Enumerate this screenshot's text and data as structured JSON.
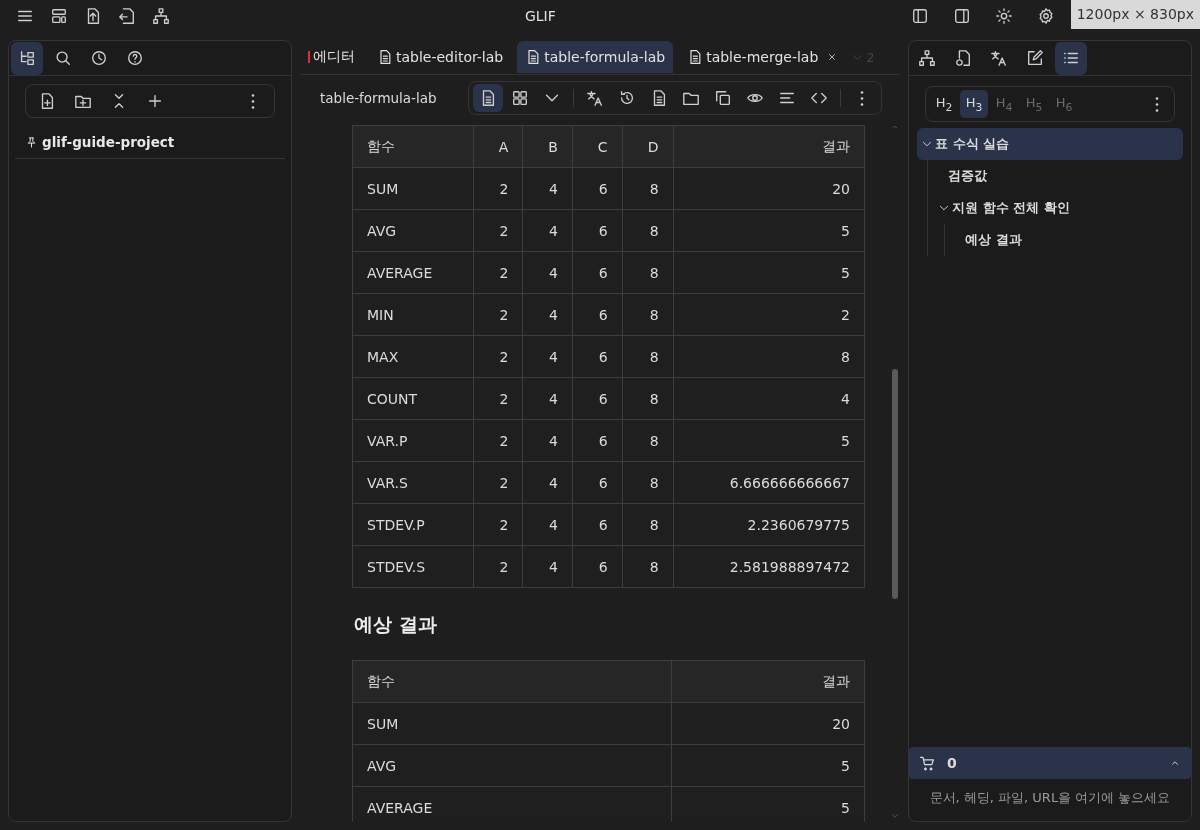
{
  "window": {
    "title": "GLIF",
    "left_icons": [
      {
        "kind": "menu"
      },
      {
        "kind": "layout"
      },
      {
        "kind": "export"
      },
      {
        "kind": "import"
      },
      {
        "kind": "tree"
      }
    ],
    "right_icons": [
      {
        "kind": "sidebar-left"
      },
      {
        "kind": "sidebar-right"
      },
      {
        "kind": "sun"
      },
      {
        "kind": "gear"
      }
    ]
  },
  "size_badge": "1200px × 830px",
  "left_panel": {
    "tabs": [
      {
        "kind": "files",
        "selected": true
      },
      {
        "kind": "search",
        "selected": false
      },
      {
        "kind": "clock",
        "selected": false
      },
      {
        "kind": "help",
        "selected": false
      }
    ],
    "tools": [
      {
        "kind": "new-file"
      },
      {
        "kind": "new-folder"
      },
      {
        "kind": "collapse"
      },
      {
        "kind": "plus"
      }
    ],
    "items": [
      {
        "label": "glif-guide-project",
        "pinned": true
      }
    ]
  },
  "editor": {
    "tabs": [
      {
        "label": "에디터",
        "selected": false,
        "warning": true,
        "closable": false
      },
      {
        "label": "table-editor-lab",
        "selected": false,
        "warning": false,
        "closable": false
      },
      {
        "label": "table-formula-lab",
        "selected": true,
        "warning": false,
        "closable": false
      },
      {
        "label": "table-merge-lab",
        "selected": false,
        "warning": false,
        "closable": true
      }
    ],
    "overflow_count": "2",
    "breadcrumb": "table-formula-lab",
    "toolbar": [
      {
        "kind": "doc",
        "selected": true
      },
      {
        "kind": "grid",
        "selected": false
      },
      {
        "kind": "chevron",
        "selected": false
      },
      {
        "kind": "translate",
        "selected": false
      },
      {
        "kind": "history",
        "selected": false
      },
      {
        "kind": "doc",
        "selected": false
      },
      {
        "kind": "folder",
        "selected": false
      },
      {
        "kind": "copy",
        "selected": false
      },
      {
        "kind": "eye",
        "selected": false
      },
      {
        "kind": "align",
        "selected": false
      },
      {
        "kind": "code",
        "selected": false
      }
    ],
    "blocks": [
      {
        "kind": "table",
        "columns": [
          "함수",
          "A",
          "B",
          "C",
          "D",
          "결과"
        ],
        "rows": [
          [
            "SUM",
            "2",
            "4",
            "6",
            "8",
            "20"
          ],
          [
            "AVG",
            "2",
            "4",
            "6",
            "8",
            "5"
          ],
          [
            "AVERAGE",
            "2",
            "4",
            "6",
            "8",
            "5"
          ],
          [
            "MIN",
            "2",
            "4",
            "6",
            "8",
            "2"
          ],
          [
            "MAX",
            "2",
            "4",
            "6",
            "8",
            "8"
          ],
          [
            "COUNT",
            "2",
            "4",
            "6",
            "8",
            "4"
          ],
          [
            "VAR.P",
            "2",
            "4",
            "6",
            "8",
            "5"
          ],
          [
            "VAR.S",
            "2",
            "4",
            "6",
            "8",
            "6.666666666667"
          ],
          [
            "STDEV.P",
            "2",
            "4",
            "6",
            "8",
            "2.2360679775"
          ],
          [
            "STDEV.S",
            "2",
            "4",
            "6",
            "8",
            "2.581988897472"
          ]
        ]
      },
      {
        "kind": "heading",
        "text": "예상 결과"
      },
      {
        "kind": "table",
        "columns": [
          "함수",
          "결과"
        ],
        "rows": [
          [
            "SUM",
            "20"
          ],
          [
            "AVG",
            "5"
          ],
          [
            "AVERAGE",
            "5"
          ]
        ]
      }
    ]
  },
  "right_panel": {
    "tabs": [
      {
        "kind": "tree",
        "selected": false
      },
      {
        "kind": "file-link",
        "selected": false
      },
      {
        "kind": "translate",
        "selected": false
      },
      {
        "kind": "edit",
        "selected": false
      },
      {
        "kind": "list",
        "selected": true
      }
    ],
    "heading_levels": [
      {
        "label": "H$_{2}$",
        "selected": false,
        "disabled": false
      },
      {
        "label": "H$_{3}$",
        "selected": true,
        "disabled": false
      },
      {
        "label": "H$_{4}$",
        "selected": false,
        "disabled": true
      },
      {
        "label": "H$_{5}$",
        "selected": false,
        "disabled": true
      },
      {
        "label": "H$_{6}$",
        "selected": false,
        "disabled": true
      }
    ],
    "outline": [
      {
        "label": "표 수식 실습",
        "selected": true,
        "expanded": true,
        "children": [
          {
            "label": "검증값",
            "selected": false
          },
          {
            "label": "지원 함수 전체 확인",
            "selected": false,
            "expanded": true,
            "children": [
              {
                "label": "예상 결과",
                "selected": false
              }
            ]
          }
        ]
      }
    ],
    "basket": {
      "count": "0",
      "hint": "문서, 헤딩, 파일, URL을 여기에 놓으세요"
    }
  }
}
